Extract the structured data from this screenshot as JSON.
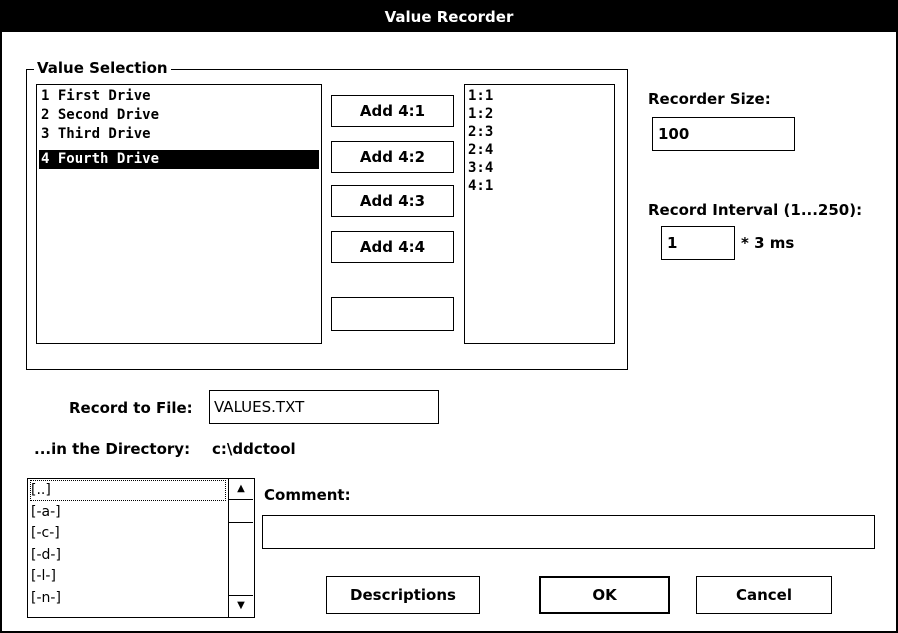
{
  "window": {
    "title": "Value Recorder"
  },
  "value_selection": {
    "group_label": "Value Selection",
    "drives": [
      "1 First Drive",
      "2 Second Drive",
      "3 Third Drive",
      "4 Fourth Drive"
    ],
    "selected_drive_index": 3,
    "add_buttons": [
      "Add 4:1",
      "Add 4:2",
      "Add 4:3",
      "Add 4:4",
      ""
    ],
    "selected_values": [
      "1:1",
      "1:2",
      "2:3",
      "2:4",
      "3:4",
      "4:1"
    ]
  },
  "recorder_size": {
    "label": "Recorder Size:",
    "value": "100"
  },
  "record_interval": {
    "label": "Record Interval (1...250):",
    "value": "1",
    "unit": "* 3 ms"
  },
  "record_file": {
    "label": "Record to File:",
    "value": "VALUES.TXT"
  },
  "directory": {
    "label": "...in the Directory:",
    "value": "c:\\ddctool"
  },
  "directory_list": [
    "[..]",
    "[-a-]",
    "[-c-]",
    "[-d-]",
    "[-l-]",
    "[-n-]"
  ],
  "comment": {
    "label": "Comment:",
    "value": ""
  },
  "buttons": {
    "descriptions": "Descriptions",
    "ok": "OK",
    "cancel": "Cancel"
  },
  "icons": {
    "scroll_up": "arrow-up-icon",
    "scroll_down": "arrow-down-icon"
  }
}
